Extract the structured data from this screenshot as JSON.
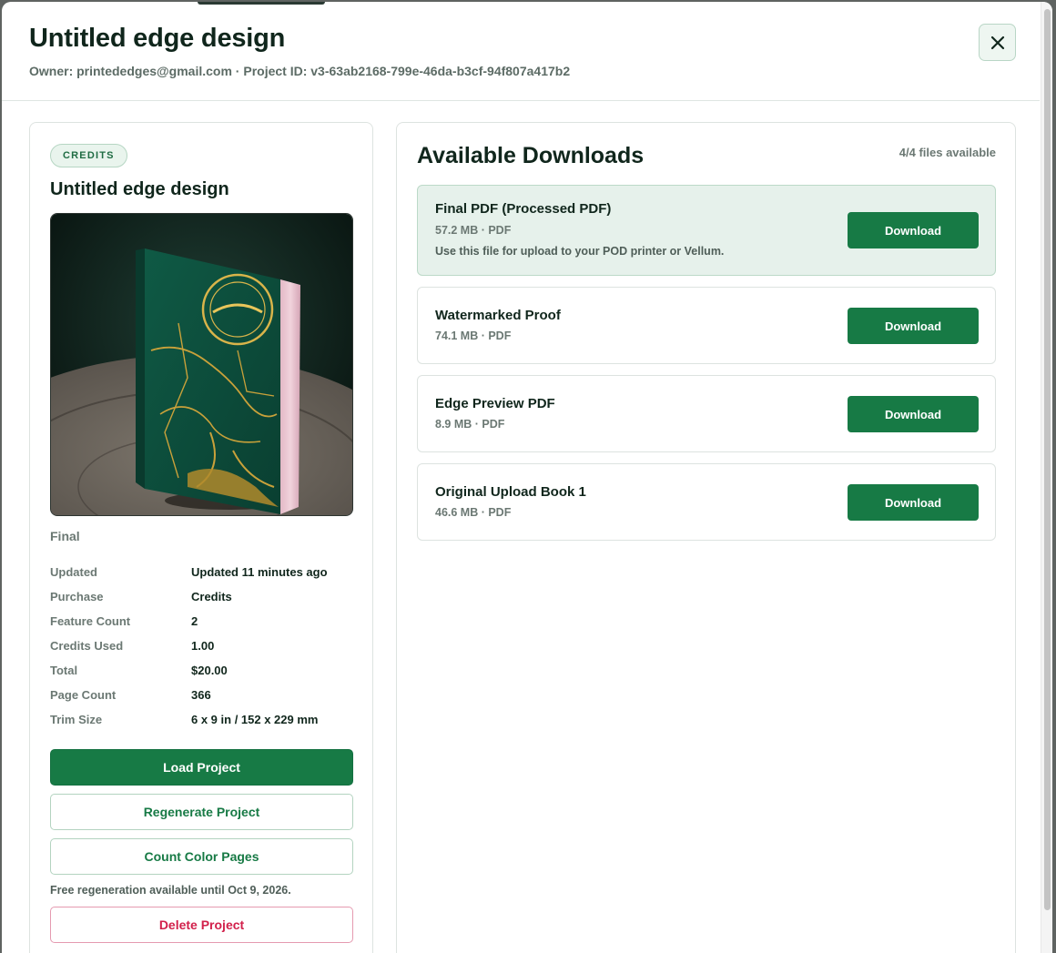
{
  "header": {
    "title": "Untitled edge design",
    "subtitle": "Owner: printededges@gmail.com · Project ID: v3-63ab2168-799e-46da-b3cf-94f807a417b2",
    "close_icon": "close-icon"
  },
  "project": {
    "badge": "CREDITS",
    "title": "Untitled edge design",
    "status": "Final",
    "details": [
      {
        "key": "Updated",
        "value": "Updated 11 minutes ago"
      },
      {
        "key": "Purchase",
        "value": "Credits"
      },
      {
        "key": "Feature Count",
        "value": "2"
      },
      {
        "key": "Credits Used",
        "value": "1.00"
      },
      {
        "key": "Total",
        "value": "$20.00"
      },
      {
        "key": "Page Count",
        "value": "366"
      },
      {
        "key": "Trim Size",
        "value": "6 x 9 in / 152 x 229 mm"
      }
    ],
    "buttons": {
      "load": "Load Project",
      "regenerate": "Regenerate Project",
      "count_color": "Count Color Pages",
      "delete": "Delete Project"
    },
    "regen_note": "Free regeneration available until Oct 9, 2026."
  },
  "downloads": {
    "title": "Available Downloads",
    "count": "4/4 files available",
    "button_label": "Download",
    "items": [
      {
        "name": "Final PDF (Processed PDF)",
        "meta": "57.2 MB · PDF",
        "note": "Use this file for upload to your POD printer or Vellum."
      },
      {
        "name": "Watermarked Proof",
        "meta": "74.1 MB · PDF"
      },
      {
        "name": "Edge Preview PDF",
        "meta": "8.9 MB · PDF"
      },
      {
        "name": "Original Upload Book 1",
        "meta": "46.6 MB · PDF"
      }
    ]
  },
  "colors": {
    "primary": "#177a45",
    "danger": "#d2204b",
    "heading": "#10261c",
    "muted": "#6b7873",
    "featured_bg": "#e6f1eb"
  }
}
